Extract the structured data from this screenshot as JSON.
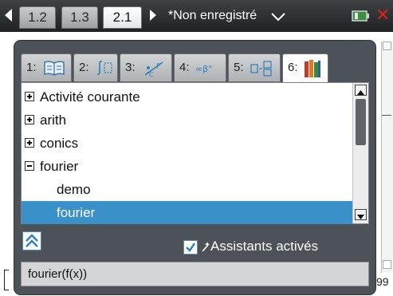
{
  "topbar": {
    "tabs": [
      {
        "label": "1.2",
        "active": false
      },
      {
        "label": "1.3",
        "active": false
      },
      {
        "label": "2.1",
        "active": true
      }
    ],
    "document_title": "*Non enregistré"
  },
  "background": {
    "partial_value": "99"
  },
  "catalog": {
    "tabs": [
      {
        "number": "1:",
        "icon": "book-icon"
      },
      {
        "number": "2:",
        "icon": "integral-icon"
      },
      {
        "number": "3:",
        "icon": "units-icon"
      },
      {
        "number": "4:",
        "icon": "symbols-icon"
      },
      {
        "number": "5:",
        "icon": "templates-icon"
      },
      {
        "number": "6:",
        "icon": "library-icon",
        "active": true
      }
    ],
    "items": [
      {
        "label": "Activité courante",
        "expander": "plus",
        "indent": 0
      },
      {
        "label": "arith",
        "expander": "plus",
        "indent": 0
      },
      {
        "label": "conics",
        "expander": "plus",
        "indent": 0
      },
      {
        "label": "fourier",
        "expander": "minus",
        "indent": 0
      },
      {
        "label": "demo",
        "expander": null,
        "indent": 1
      },
      {
        "label": "fourier",
        "expander": null,
        "indent": 1,
        "selected": true
      }
    ],
    "wizards_label": "Assistants activés",
    "wizards_checked": true,
    "syntax": "fourier(f(x))"
  },
  "colors": {
    "selection": "#3a90c8",
    "dialog_bg": "#4c5257",
    "close": "#d4241c"
  }
}
